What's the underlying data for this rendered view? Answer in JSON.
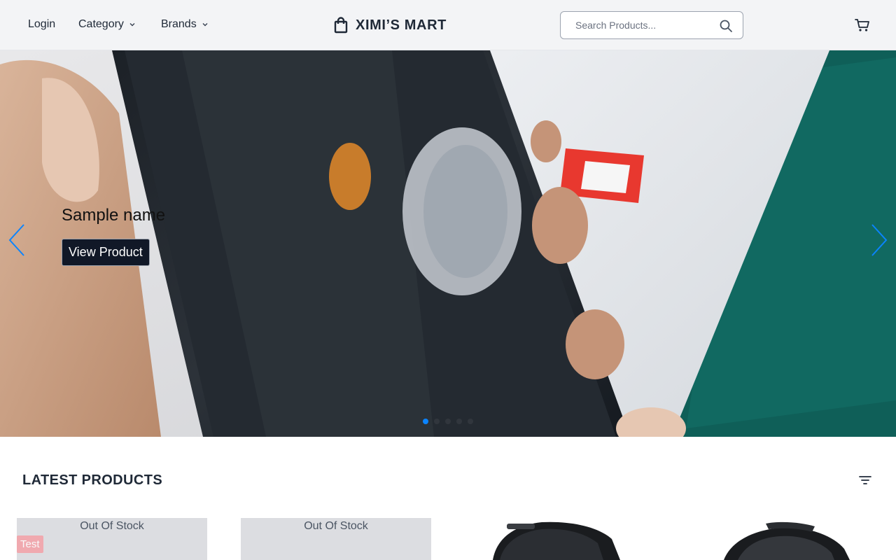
{
  "header": {
    "nav": {
      "login": "Login",
      "category": "Category",
      "brands": "Brands"
    },
    "brand_name": "XIMI’S MART",
    "search_placeholder": "Search Products...",
    "icons": [
      "shopping-bag-icon",
      "search-icon",
      "cart-icon",
      "chevron-down-icon"
    ]
  },
  "hero": {
    "caption_name": "Sample name",
    "cta_label": "View Product",
    "slide_count": 5,
    "active_slide": 1,
    "indicator_color": "#0a84ff"
  },
  "latest": {
    "title": "LATEST PRODUCTS",
    "products": [
      {
        "status": "Out Of Stock",
        "tag": "Test"
      },
      {
        "status": "Out Of Stock",
        "tag": ""
      },
      {
        "status": "",
        "tag": ""
      },
      {
        "status": "",
        "tag": ""
      }
    ]
  },
  "colors": {
    "header_bg": "#f3f4f6",
    "accent": "#0a84ff",
    "dark_button": "#111827",
    "tag_bg": "#f4a0a7"
  }
}
